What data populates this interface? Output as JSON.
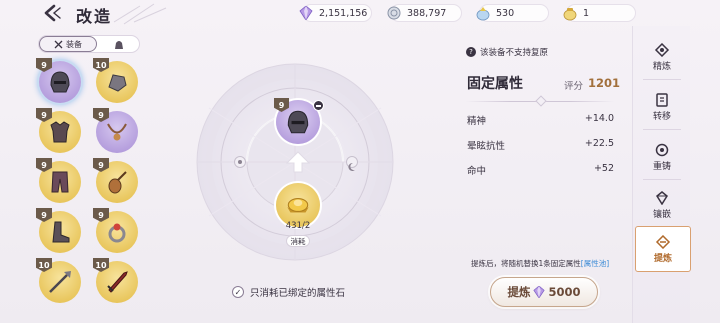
{
  "header": {
    "title": "改造",
    "currencies": [
      {
        "icon": "crystal-icon",
        "value": "2,151,156"
      },
      {
        "icon": "silver-coin-icon",
        "value": "388,797"
      },
      {
        "icon": "gem-pouch-icon",
        "value": "530"
      },
      {
        "icon": "gold-pouch-icon",
        "value": "1"
      }
    ]
  },
  "left": {
    "filter_equip_label": "装备",
    "items": [
      {
        "name": "helmet",
        "level": "9",
        "color": "purple",
        "selected": true
      },
      {
        "name": "gauntlet",
        "level": "10",
        "color": "gold"
      },
      {
        "name": "armor",
        "level": "9",
        "color": "gold"
      },
      {
        "name": "necklace",
        "level": "9",
        "color": "purple"
      },
      {
        "name": "pants",
        "level": "9",
        "color": "gold"
      },
      {
        "name": "lute",
        "level": "9",
        "color": "gold"
      },
      {
        "name": "boots",
        "level": "9",
        "color": "gold"
      },
      {
        "name": "ring",
        "level": "9",
        "color": "gold"
      },
      {
        "name": "spear",
        "level": "10",
        "color": "gold"
      },
      {
        "name": "sword",
        "level": "10",
        "color": "gold"
      }
    ]
  },
  "center": {
    "top_level": "9",
    "material_count": "431/2",
    "consume_label": "消耗",
    "checkbox_label": "只消耗已绑定的属性石"
  },
  "attributes": {
    "notice": "该装备不支持复原",
    "title": "固定属性",
    "score_label": "评分",
    "score_value": "1201",
    "rows": [
      {
        "name": "精神",
        "value": "+14.0"
      },
      {
        "name": "晕眩抗性",
        "value": "+22.5"
      },
      {
        "name": "命中",
        "value": "+52"
      }
    ],
    "refine_info": "提炼后，将随机替换1条固定属性",
    "refine_link": "[属性池]",
    "refine_button": "提炼",
    "refine_cost": "5000"
  },
  "nav": {
    "items": [
      {
        "label": "精炼",
        "icon": "refine-icon"
      },
      {
        "label": "转移",
        "icon": "transfer-icon"
      },
      {
        "label": "重铸",
        "icon": "recast-icon"
      },
      {
        "label": "镶嵌",
        "icon": "inlay-icon"
      },
      {
        "label": "提炼",
        "icon": "extract-icon",
        "active": true
      }
    ]
  },
  "colors": {
    "accent": "#b06a2c",
    "gold": "#e9c24a",
    "purple": "#a88ed6",
    "link": "#3a8ad6"
  }
}
